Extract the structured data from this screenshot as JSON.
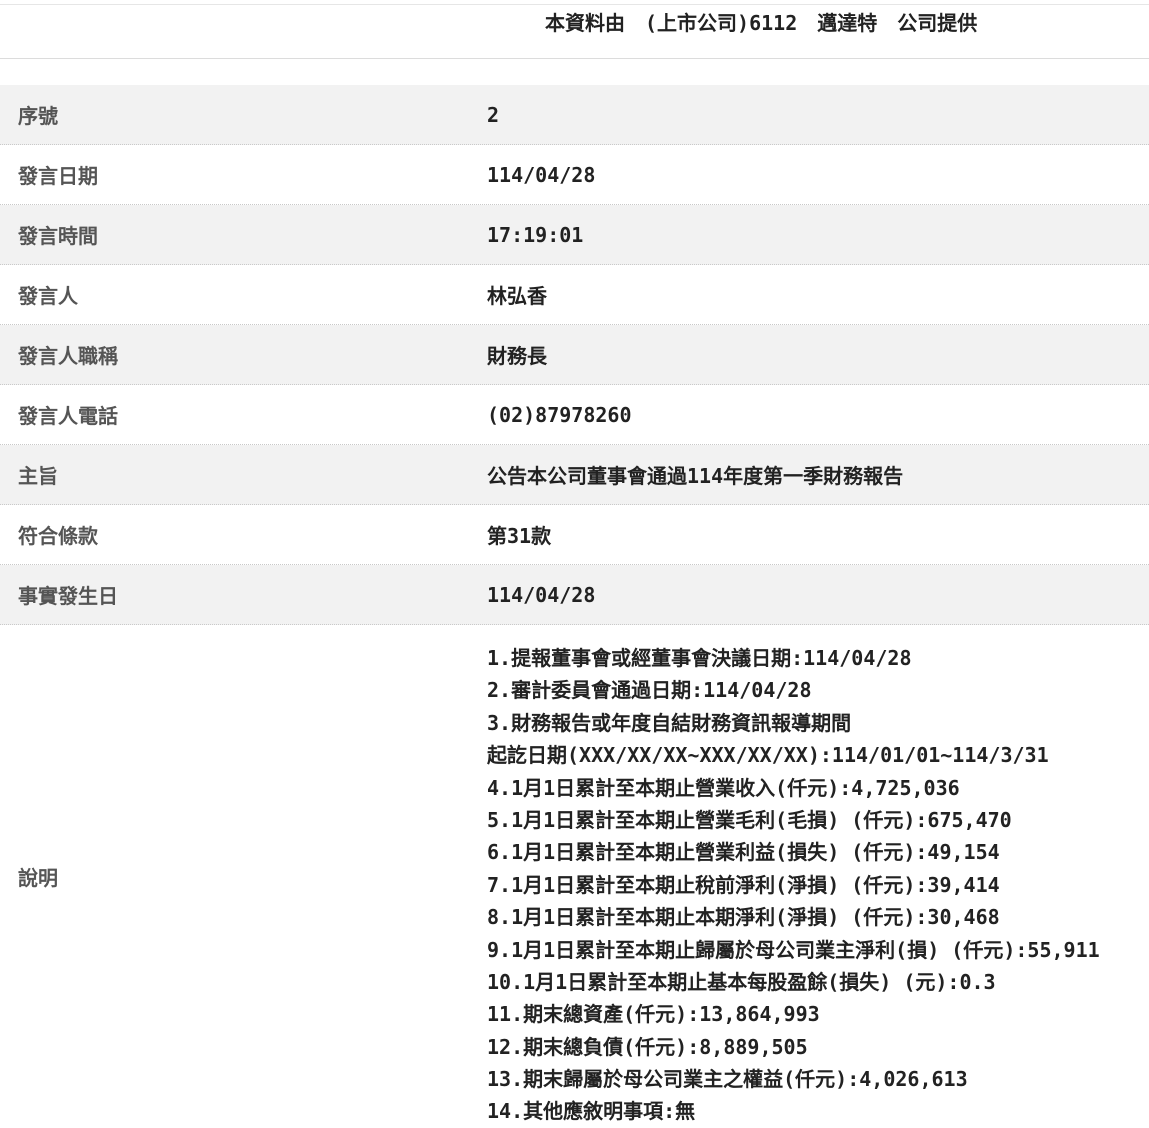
{
  "header": {
    "provider_text": "本資料由　(上市公司)6112　邁達特　公司提供"
  },
  "rows": [
    {
      "label": "序號",
      "value": "2"
    },
    {
      "label": "發言日期",
      "value": "114/04/28"
    },
    {
      "label": "發言時間",
      "value": "17:19:01"
    },
    {
      "label": "發言人",
      "value": "林弘香"
    },
    {
      "label": "發言人職稱",
      "value": "財務長"
    },
    {
      "label": "發言人電話",
      "value": "(02)87978260"
    },
    {
      "label": "主旨",
      "value": "公告本公司董事會通過114年度第一季財務報告"
    },
    {
      "label": "符合條款",
      "value": "第31款"
    },
    {
      "label": "事實發生日",
      "value": "114/04/28"
    }
  ],
  "description": {
    "label": "說明",
    "lines": [
      "1.提報董事會或經董事會決議日期:114/04/28",
      "2.審計委員會通過日期:114/04/28",
      "3.財務報告或年度自結財務資訊報導期間",
      "起訖日期(XXX/XX/XX~XXX/XX/XX):114/01/01~114/3/31",
      "4.1月1日累計至本期止營業收入(仟元):4,725,036",
      "5.1月1日累計至本期止營業毛利(毛損) (仟元):675,470",
      "6.1月1日累計至本期止營業利益(損失) (仟元):49,154",
      "7.1月1日累計至本期止稅前淨利(淨損) (仟元):39,414",
      "8.1月1日累計至本期止本期淨利(淨損) (仟元):30,468",
      "9.1月1日累計至本期止歸屬於母公司業主淨利(損) (仟元):55,911",
      "10.1月1日累計至本期止基本每股盈餘(損失) (元):0.3",
      "11.期末總資產(仟元):13,864,993",
      "12.期末總負債(仟元):8,889,505",
      "13.期末歸屬於母公司業主之權益(仟元):4,026,613",
      "14.其他應敘明事項:無"
    ]
  }
}
